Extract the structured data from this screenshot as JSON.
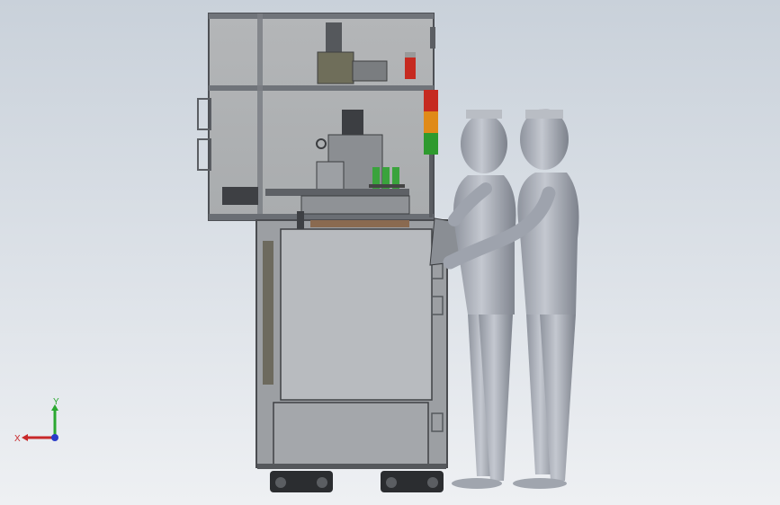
{
  "viewport": {
    "background_top": "#c9d1da",
    "background_bottom": "#eef0f3"
  },
  "triad": {
    "x_label": "X",
    "y_label": "Y",
    "x_color": "#c8282a",
    "y_color": "#2aa830",
    "z_color": "#2a3cc8"
  },
  "model": {
    "stack_light_colors": [
      "#c62a20",
      "#e08a18",
      "#2e9a2e"
    ],
    "frame_color": "#6c6f74",
    "panel_color": "#b9bcc0",
    "mannequin_color": "#a9aeb8"
  }
}
